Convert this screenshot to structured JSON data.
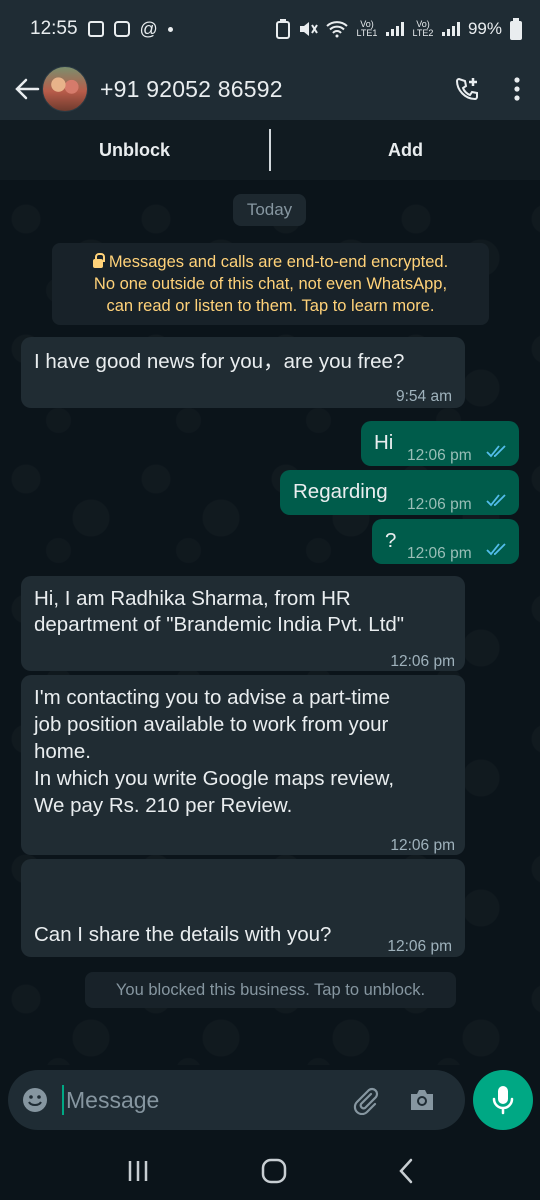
{
  "status_bar": {
    "time": "12:55",
    "battery": "99%",
    "sim1_label": "Vo) LTE1",
    "sim2_label": "Vo) LTE2",
    "left_icons": [
      "notification-icon",
      "photo-icon",
      "threads-icon"
    ],
    "right_icons": [
      "battery-saver-icon",
      "mute-icon",
      "wifi-icon",
      "signal-icon"
    ]
  },
  "header": {
    "contact_name": "+91 92052 86592",
    "icons": [
      "back-arrow-icon",
      "add-call-icon",
      "more-options-icon"
    ]
  },
  "action_bar": {
    "unblock_label": "Unblock",
    "add_label": "Add"
  },
  "chat": {
    "date_label": "Today",
    "encryption_notice": "Messages and calls are end-to-end encrypted. No one outside of this chat, not even WhatsApp, can read or listen to them. Tap to learn more.",
    "encryption_lines": [
      "Messages and calls are end-to-end encrypted.",
      "No one outside of this chat, not even WhatsApp,",
      "can read or listen to them. Tap to learn more."
    ],
    "messages": [
      {
        "direction": "incoming",
        "lines": [
          "I have good news for you，are you free?"
        ],
        "time": "9:54 am"
      },
      {
        "direction": "outgoing",
        "lines": [
          "Hi"
        ],
        "time": "12:06 pm",
        "status": "read"
      },
      {
        "direction": "outgoing",
        "lines": [
          "Regarding"
        ],
        "time": "12:06 pm",
        "status": "read"
      },
      {
        "direction": "outgoing",
        "lines": [
          "?"
        ],
        "time": "12:06 pm",
        "status": "read"
      },
      {
        "direction": "incoming",
        "lines": [
          "Hi, I am Radhika  Sharma, from HR",
          "department of \"Brandemic India Pvt. Ltd\""
        ],
        "time": "12:06 pm"
      },
      {
        "direction": "incoming",
        "lines": [
          "I'm contacting you to advise a part-time",
          "job position available to work from your",
          "home.",
          "In which you write Google maps review,",
          "We pay Rs. 210 per Review."
        ],
        "time": "12:06 pm"
      },
      {
        "direction": "incoming",
        "lines": [
          "",
          "",
          "Can I share the details with you?"
        ],
        "time": "12:06 pm"
      }
    ],
    "blocked_notice": "You blocked this business. Tap to unblock."
  },
  "composer": {
    "placeholder": "Message",
    "value": "",
    "icons": [
      "emoji-icon",
      "attach-icon",
      "camera-icon",
      "mic-icon"
    ]
  },
  "nav_bar": {
    "icons": [
      "recent-apps-icon",
      "home-icon",
      "back-icon"
    ]
  },
  "colors": {
    "background": "#0b141a",
    "bar": "#1f2c34",
    "incoming_bubble": "#202c33",
    "outgoing_bubble": "#005c4b",
    "accent": "#00a884",
    "notice_text": "#ffd279",
    "read_ticks": "#53bdeb"
  }
}
